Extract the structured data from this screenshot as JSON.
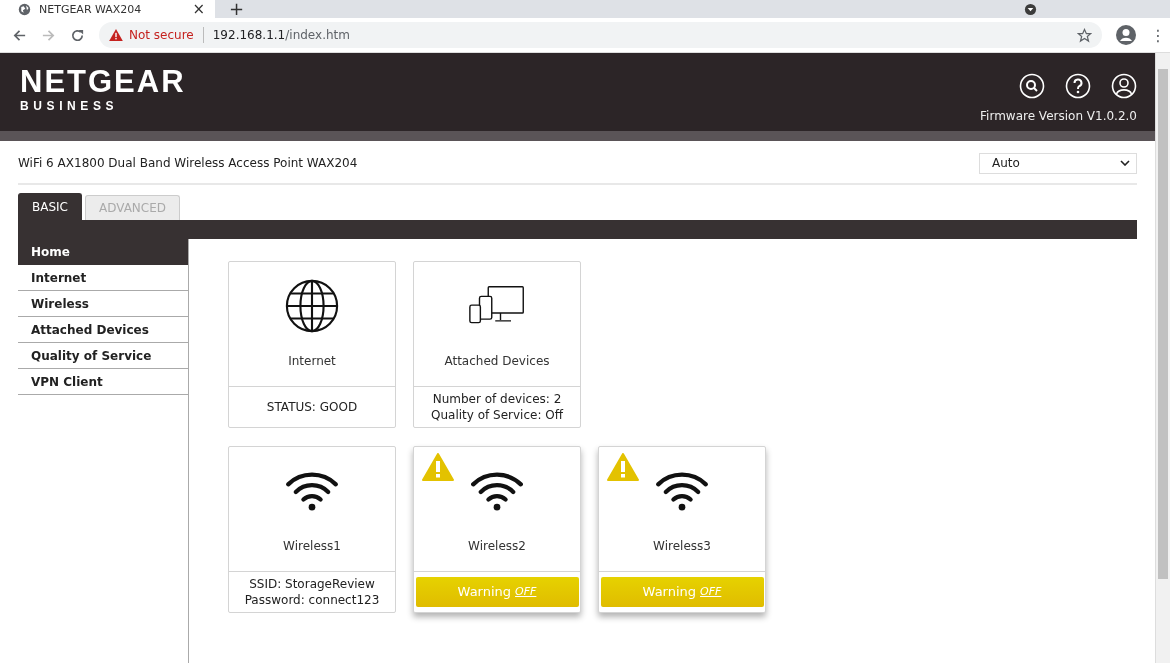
{
  "browser": {
    "tab_title": "NETGEAR WAX204",
    "close": "×",
    "new_tab": "+",
    "security": "Not secure",
    "url_host": "192.168.1.1",
    "url_path": "/index.htm",
    "menu": "⋮"
  },
  "header": {
    "brand": "NETGEAR",
    "sub": "BUSINESS",
    "firmware": "Firmware Version V1.0.2.0"
  },
  "product": "WiFi 6 AX1800 Dual Band Wireless Access Point WAX204",
  "language_select": {
    "value": "Auto"
  },
  "tabs": [
    {
      "label": "BASIC",
      "selected": true
    },
    {
      "label": "ADVANCED",
      "selected": false
    }
  ],
  "sidebar": {
    "items": [
      {
        "label": "Home",
        "selected": true
      },
      {
        "label": "Internet",
        "selected": false
      },
      {
        "label": "Wireless",
        "selected": false
      },
      {
        "label": "Attached Devices",
        "selected": false
      },
      {
        "label": "Quality of Service",
        "selected": false
      },
      {
        "label": "VPN Client",
        "selected": false
      }
    ]
  },
  "tile_rows": [
    [
      {
        "kind": "internet",
        "label": "Internet",
        "warning": false,
        "lines": [
          "STATUS: GOOD"
        ]
      },
      {
        "kind": "devices",
        "label": "Attached Devices",
        "warning": false,
        "lines": [
          "Number of devices: 2",
          "Quality of Service: Off"
        ]
      }
    ],
    [
      {
        "kind": "wireless",
        "label": "Wireless1",
        "warning": false,
        "lines": [
          "SSID: StorageReview",
          "Password: connect123"
        ]
      },
      {
        "kind": "wireless-alert",
        "label": "Wireless2",
        "warning": true,
        "alert_text": "Warning",
        "alert_link": "OFF"
      },
      {
        "kind": "wireless-alert",
        "label": "Wireless3",
        "warning": true,
        "alert_text": "Warning",
        "alert_link": "OFF"
      }
    ]
  ]
}
